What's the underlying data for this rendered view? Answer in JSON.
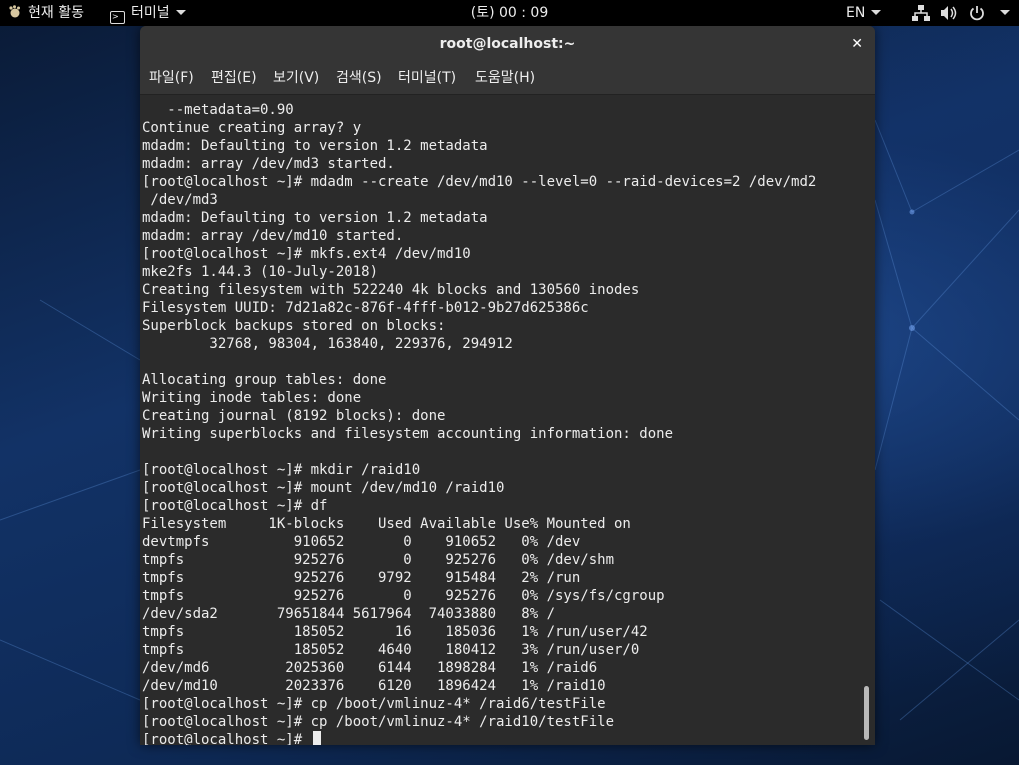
{
  "topbar": {
    "activities_label": "현재 활동",
    "app_menu_label": "터미널",
    "clock": "(토) 00 : 09",
    "language": "EN"
  },
  "window": {
    "title": "root@localhost:~",
    "close_glyph": "✕"
  },
  "menubar": {
    "items": [
      "파일(F)",
      "편집(E)",
      "보기(V)",
      "검색(S)",
      "터미널(T)",
      "도움말(H)"
    ]
  },
  "terminal": {
    "lines": [
      "   --metadata=0.90",
      "Continue creating array? y",
      "mdadm: Defaulting to version 1.2 metadata",
      "mdadm: array /dev/md3 started.",
      "[root@localhost ~]# mdadm --create /dev/md10 --level=0 --raid-devices=2 /dev/md2",
      " /dev/md3",
      "mdadm: Defaulting to version 1.2 metadata",
      "mdadm: array /dev/md10 started.",
      "[root@localhost ~]# mkfs.ext4 /dev/md10",
      "mke2fs 1.44.3 (10-July-2018)",
      "Creating filesystem with 522240 4k blocks and 130560 inodes",
      "Filesystem UUID: 7d21a82c-876f-4fff-b012-9b27d625386c",
      "Superblock backups stored on blocks:",
      "        32768, 98304, 163840, 229376, 294912",
      "",
      "Allocating group tables: done",
      "Writing inode tables: done",
      "Creating journal (8192 blocks): done",
      "Writing superblocks and filesystem accounting information: done",
      "",
      "[root@localhost ~]# mkdir /raid10",
      "[root@localhost ~]# mount /dev/md10 /raid10",
      "[root@localhost ~]# df",
      "Filesystem     1K-blocks    Used Available Use% Mounted on",
      "devtmpfs          910652       0    910652   0% /dev",
      "tmpfs             925276       0    925276   0% /dev/shm",
      "tmpfs             925276    9792    915484   2% /run",
      "tmpfs             925276       0    925276   0% /sys/fs/cgroup",
      "/dev/sda2       79651844 5617964  74033880   8% /",
      "tmpfs             185052      16    185036   1% /run/user/42",
      "tmpfs             185052    4640    180412   3% /run/user/0",
      "/dev/md6         2025360    6144   1898284   1% /raid6",
      "/dev/md10        2023376    6120   1896424   1% /raid10",
      "[root@localhost ~]# cp /boot/vmlinuz-4* /raid6/testFile",
      "[root@localhost ~]# cp /boot/vmlinuz-4* /raid10/testFile",
      "[root@localhost ~]#"
    ]
  }
}
